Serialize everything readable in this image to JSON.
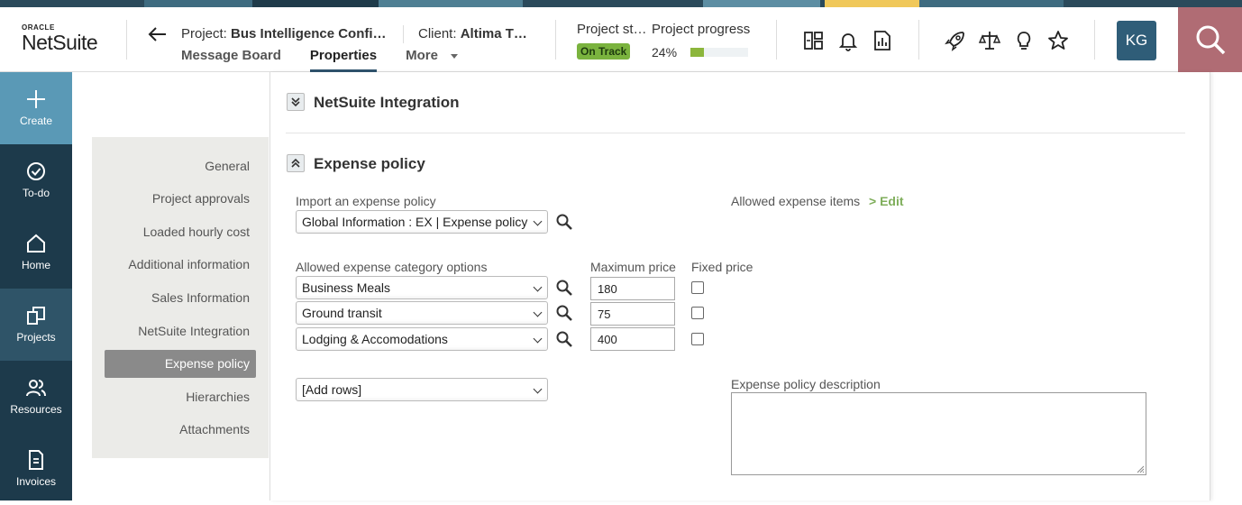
{
  "brand": {
    "oracle": "ORACLE",
    "netsuite": "NetSuite"
  },
  "header": {
    "project_prefix": "Project:",
    "project_name": "Bus Intelligence Confi…",
    "client_prefix": "Client:",
    "client_name": "Altima T…",
    "tabs": [
      {
        "label": "Message Board"
      },
      {
        "label": "Properties"
      },
      {
        "label": "More"
      }
    ],
    "status_label": "Project st…",
    "status_badge": "On Track",
    "progress_label": "Project progress",
    "progress_text": "24%",
    "progress_value": 0.24,
    "avatar_initials": "KG"
  },
  "sidebar": {
    "items": [
      {
        "label": "Create"
      },
      {
        "label": "To-do"
      },
      {
        "label": "Home"
      },
      {
        "label": "Projects"
      },
      {
        "label": "Resources"
      },
      {
        "label": "Invoices"
      }
    ]
  },
  "subnav": {
    "items": [
      {
        "label": "General"
      },
      {
        "label": "Project approvals"
      },
      {
        "label": "Loaded hourly cost"
      },
      {
        "label": "Additional information"
      },
      {
        "label": "Sales Information"
      },
      {
        "label": "NetSuite Integration"
      },
      {
        "label": "Expense policy"
      },
      {
        "label": "Hierarchies"
      },
      {
        "label": "Attachments"
      }
    ]
  },
  "sections": {
    "netsuite_title": "NetSuite Integration",
    "expense_title": "Expense policy"
  },
  "form": {
    "import_label": "Import an expense policy",
    "import_value": "Global Information : EX | Expense policy",
    "allowed_items_label": "Allowed expense items",
    "edit_link": "> Edit",
    "category_label": "Allowed expense category options",
    "max_price_label": "Maximum price",
    "fixed_price_label": "Fixed price",
    "rows": [
      {
        "category": "Business Meals",
        "price": "180"
      },
      {
        "category": "Ground transit",
        "price": "75"
      },
      {
        "category": "Lodging & Accomodations",
        "price": "400"
      }
    ],
    "add_rows": "[Add rows]",
    "description_label": "Expense policy description"
  },
  "colors": {
    "sidebar": "#1d3a4b",
    "create_bg": "#5a99b6",
    "badge": "#7ab33e",
    "search_bg": "#b06c74"
  }
}
